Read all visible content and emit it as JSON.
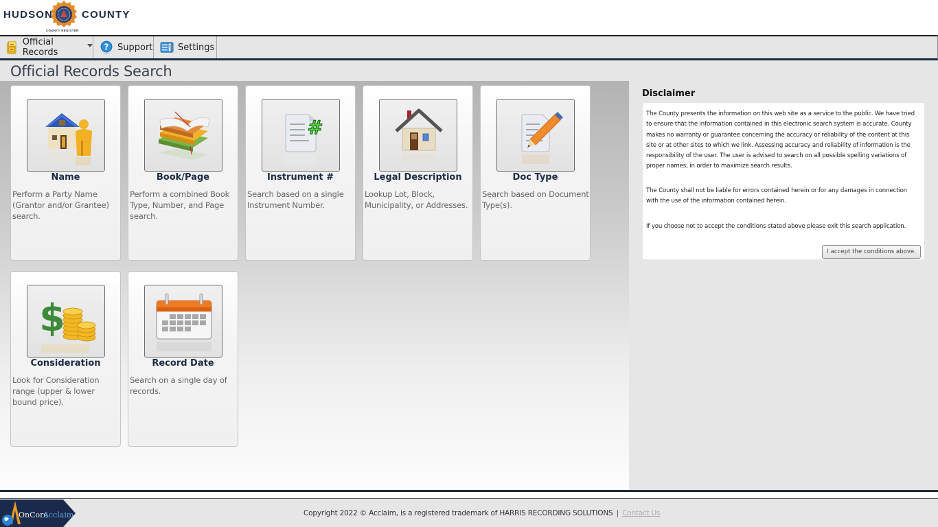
{
  "header": {
    "logo_left": "HUDSON",
    "logo_right": "COUNTY",
    "logo_sub": "COUNTY REGISTER"
  },
  "menu": {
    "items": [
      {
        "label": "Official Records",
        "icon": "file-cabinet-icon",
        "has_dropdown": true
      },
      {
        "label": "Support",
        "icon": "help-icon"
      },
      {
        "label": "Settings",
        "icon": "settings-icon"
      }
    ]
  },
  "page": {
    "title": "Official Records Search"
  },
  "search_cards": [
    {
      "title": "Name",
      "icon": "house-person-icon",
      "description": "Perform a Party Name (Grantor and/or Grantee) search."
    },
    {
      "title": "Book/Page",
      "icon": "books-icon",
      "description": "Perform a combined Book Type, Number, and Page search."
    },
    {
      "title": "Instrument #",
      "icon": "document-hash-icon",
      "description": "Search based on a single Instrument Number."
    },
    {
      "title": "Legal Description",
      "icon": "house-icon",
      "description": "Lookup Lot, Block, Municipality, or Addresses."
    },
    {
      "title": "Doc Type",
      "icon": "document-pencil-icon",
      "description": "Search based on Document Type(s)."
    },
    {
      "title": "Consideration",
      "icon": "dollar-coins-icon",
      "description": "Look for Consideration range (upper & lower bound price)."
    },
    {
      "title": "Record Date",
      "icon": "calendar-icon",
      "description": "Search on a single day of records."
    }
  ],
  "disclaimer": {
    "title": "Disclaimer",
    "paragraphs": [
      "The County presents the information on this web site as a service to the public. We have tried to ensure that the information contained in this electronic search system is accurate. County makes no warranty or guarantee concerning the accuracy or reliability of the content at this site or at other sites to which we link. Assessing accuracy and reliability of information is the responsibility of the user. The user is advised to search on all possible spelling variations of proper names, in order to maximize search results.",
      "The County shall not be liable for errors contained herein or for any damages in connection with the use of the information contained herein.",
      "If you choose not to accept the conditions stated above please exit this search application."
    ],
    "accept_label": "I accept the conditions above."
  },
  "footer": {
    "logo_text_a": "OnCore",
    "logo_text_b": "Acclaim",
    "copyright": "Copyright 2022 © Acclaim, is a registered trademark of HARRIS RECORDING SOLUTIONS",
    "separator": "|",
    "contact_label": "Contact Us"
  },
  "colors": {
    "nav_dark": "#1b2a3e",
    "card_title": "#1d2b44",
    "panel_bg": "#e6e6e6"
  }
}
